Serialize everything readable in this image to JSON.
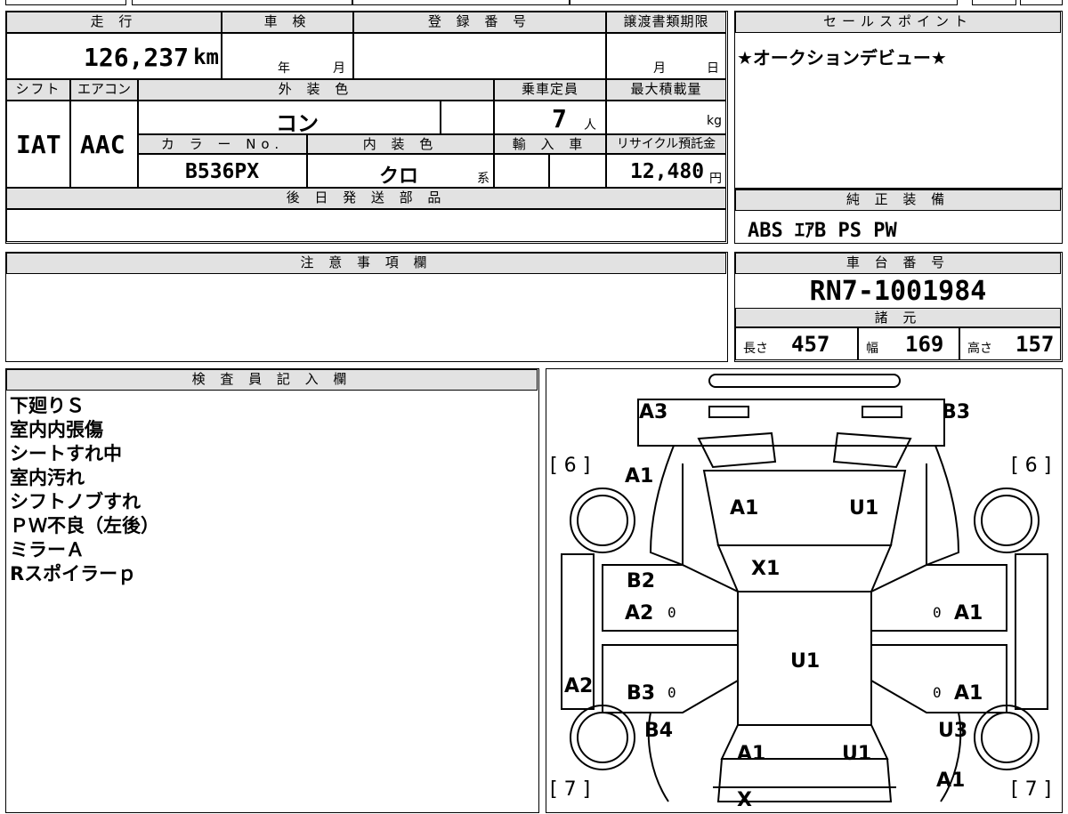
{
  "sheet": {
    "mileage": {
      "header": "走 行",
      "value": "126,237",
      "unit": "km"
    },
    "inspection": {
      "header": "車 検",
      "year_label": "年",
      "month_label": "月"
    },
    "registration": {
      "header": "登 録 番 号",
      "value": ""
    },
    "transfer_deadline": {
      "header": "譲渡書類期限",
      "month_label": "月",
      "day_label": "日"
    },
    "sales_point": {
      "header": "セールスポイント",
      "text": "★オークションデビュー★"
    },
    "shift": {
      "header": "シフト",
      "value": "IAT"
    },
    "aircon": {
      "header": "エアコン",
      "value": "AAC"
    },
    "exterior_color": {
      "header": "外 装 色",
      "value": "コン"
    },
    "capacity": {
      "header": "乗車定員",
      "value": "7",
      "unit": "人"
    },
    "max_load": {
      "header": "最大積載量",
      "value": "",
      "unit": "kg"
    },
    "color_no": {
      "header": "カ ラ ー No.",
      "value": "B536PX"
    },
    "interior_color": {
      "header": "内 装 色",
      "value": "クロ",
      "suffix": "系"
    },
    "import": {
      "header": "輸 入 車",
      "value": ""
    },
    "recycle_fee": {
      "header": "リサイクル預託金",
      "value": "12,480",
      "unit": "円"
    },
    "later_parts": {
      "header": "後 日 発 送 部 品",
      "value": ""
    },
    "genuine_equipment": {
      "header": "純 正 装 備",
      "value": "ABS ｴｱB PS PW"
    },
    "notes": {
      "header": "注 意 事 項 欄",
      "value": ""
    },
    "chassis": {
      "header": "車 台 番 号",
      "value": "RN7-1001984"
    },
    "specs": {
      "header": "諸 元",
      "length": {
        "label": "長さ",
        "value": "457"
      },
      "width": {
        "label": "幅",
        "value": "169"
      },
      "height": {
        "label": "高さ",
        "value": "157"
      }
    },
    "inspector": {
      "header": "検 査 員 記 入 欄",
      "remarks": [
        "下廻りＳ",
        "室内内張傷",
        "シートすれ中",
        "室内汚れ",
        "シフトノブすれ",
        "ＰＷ不良（左後）",
        "ミラーＡ",
        "Rスポイラーｐ"
      ]
    }
  },
  "diagram": {
    "tire_front_left": "[ 6 ]",
    "tire_front_right": "[ 6 ]",
    "tire_rear_left": "[ 7 ]",
    "tire_rear_right": "[ 7 ]",
    "marks": {
      "front_bumper_left": "A3",
      "front_bumper_right": "B3",
      "left_front_fender": "A1",
      "hood_left": "A1",
      "hood_right": "U1",
      "windshield": "X1",
      "left_front_door_1": "B2",
      "left_front_door_2": "A2",
      "left_front_door_zero": "0",
      "right_front_door_zero": "0",
      "right_front_door": "A1",
      "roof": "U1",
      "left_rocker": "A2",
      "left_rear_door": "B3",
      "left_rear_door_zero": "0",
      "right_rear_door_zero": "0",
      "right_rear_door": "A1",
      "left_quarter": "B4",
      "right_quarter": "U3",
      "trunk_left": "A1",
      "trunk_right": "U1",
      "rear_right": "A1",
      "rear_glass": "X"
    }
  }
}
